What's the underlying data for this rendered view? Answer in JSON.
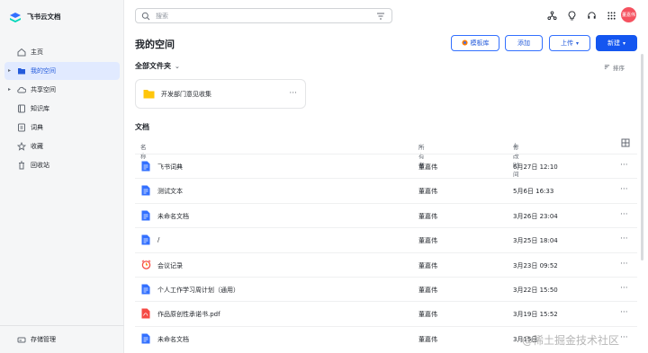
{
  "brand": {
    "name": "飞书云文档"
  },
  "sidebar": {
    "items": [
      {
        "label": "主页",
        "icon": "home-icon"
      },
      {
        "label": "我的空间",
        "icon": "folder-icon",
        "active": true
      },
      {
        "label": "共享空间",
        "icon": "cloud-icon"
      },
      {
        "label": "知识库",
        "icon": "book-icon"
      },
      {
        "label": "词典",
        "icon": "dictionary-icon"
      },
      {
        "label": "收藏",
        "icon": "star-icon"
      },
      {
        "label": "回收站",
        "icon": "trash-icon"
      }
    ],
    "storage_label": "存储管理"
  },
  "search": {
    "placeholder": "搜索"
  },
  "avatar_text": "董嘉伟",
  "header": {
    "title": "我的空间",
    "template_label": "模板库",
    "add_label": "添加",
    "upload_label": "上传",
    "new_label": "新建"
  },
  "folders": {
    "section_label": "全部文件夹",
    "sort_label": "排序",
    "items": [
      {
        "name": "开发部门意见收集"
      }
    ]
  },
  "docs": {
    "section_label": "文档",
    "columns": {
      "name": "名称",
      "owner": "所有者",
      "modified": "修改时间"
    },
    "rows": [
      {
        "type": "doc",
        "name": "飞书词典",
        "owner": "董嘉伟",
        "time": "6月27日 12:10"
      },
      {
        "type": "doc",
        "name": "测试文本",
        "owner": "董嘉伟",
        "time": "5月6日 16:33"
      },
      {
        "type": "doc",
        "name": "未命名文档",
        "owner": "董嘉伟",
        "time": "3月26日 23:04"
      },
      {
        "type": "doc",
        "name": "/",
        "owner": "董嘉伟",
        "time": "3月25日 18:04"
      },
      {
        "type": "meeting",
        "name": "会议记录",
        "owner": "董嘉伟",
        "time": "3月23日 09:52"
      },
      {
        "type": "doc",
        "name": "个人工作学习周计划（通用）",
        "owner": "董嘉伟",
        "time": "3月22日 15:50"
      },
      {
        "type": "pdf",
        "name": "作品原创性承诺书.pdf",
        "owner": "董嘉伟",
        "time": "3月19日 15:52"
      },
      {
        "type": "doc",
        "name": "未命名文档",
        "owner": "董嘉伟",
        "time": "3月15日"
      }
    ]
  },
  "watermark": "@稀土掘金技术社区",
  "colors": {
    "accent": "#3370ff",
    "primary": "#1456f0",
    "active_bg": "#e1eaff",
    "avatar": "#f5515f"
  }
}
